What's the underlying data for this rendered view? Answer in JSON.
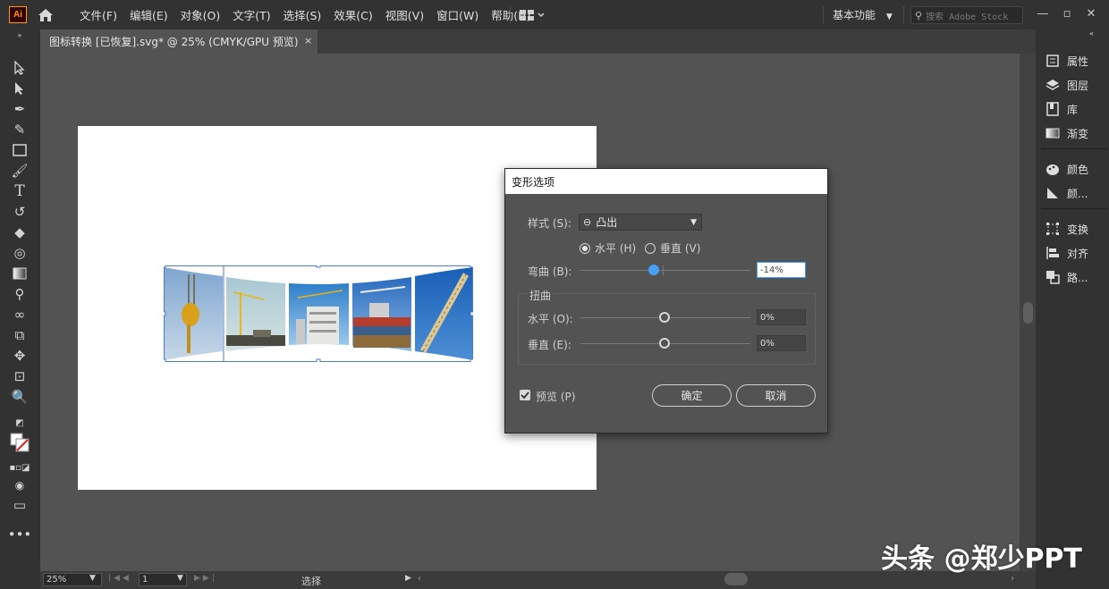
{
  "app": {
    "logo": "Ai"
  },
  "menu": [
    "文件(F)",
    "编辑(E)",
    "对象(O)",
    "文字(T)",
    "选择(S)",
    "效果(C)",
    "视图(V)",
    "窗口(W)",
    "帮助(H)"
  ],
  "workspace": {
    "label": "基本功能"
  },
  "search": {
    "placeholder": "搜索 Adobe Stock"
  },
  "document_tab": {
    "title": "图标转换 [已恢复].svg* @ 25% (CMYK/GPU 预览)",
    "close": "×"
  },
  "right_panel": {
    "items": [
      {
        "label": "属性",
        "icon": "properties-icon"
      },
      {
        "label": "图层",
        "icon": "layers-icon"
      },
      {
        "label": "库",
        "icon": "libraries-icon"
      },
      {
        "label": "渐变",
        "icon": "gradient-icon"
      },
      {
        "label": "颜色",
        "icon": "color-icon"
      },
      {
        "label": "颜...",
        "icon": "color-guide-icon"
      },
      {
        "label": "变换",
        "icon": "transform-icon"
      },
      {
        "label": "对齐",
        "icon": "align-icon"
      },
      {
        "label": "路...",
        "icon": "pathfinder-icon"
      }
    ]
  },
  "status": {
    "zoom": "25%",
    "artboard_number": "1",
    "tool": "选择"
  },
  "dialog": {
    "title": "变形选项",
    "style_label": "样式 (S):",
    "style_value": "凸出",
    "horizontal_label": "水平 (H)",
    "vertical_label": "垂直 (V)",
    "orientation": "horizontal",
    "bend_label": "弯曲 (B):",
    "bend_value": "-14%",
    "bend_fraction": 0.43,
    "distortion_group": "扭曲",
    "dist_horizontal_label": "水平 (O):",
    "dist_horizontal_value": "0%",
    "dist_vertical_label": "垂直 (E):",
    "dist_vertical_value": "0%",
    "preview_label": "预览 (P)",
    "preview_checked": true,
    "ok_label": "确定",
    "cancel_label": "取消"
  },
  "watermark": "头条 @郑少PPT",
  "colors": {
    "menubar": "#323232",
    "workspace": "#535353",
    "accent_blue": "#46a0f5",
    "artboard": "#ffffff",
    "logo_orange": "#ff9a00"
  }
}
